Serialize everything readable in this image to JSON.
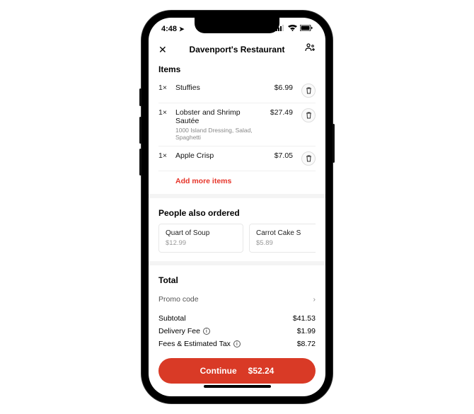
{
  "statusbar": {
    "time": "4:48"
  },
  "header": {
    "title": "Davenport's Restaurant"
  },
  "sections": {
    "items_title": "Items",
    "also_ordered_title": "People also ordered",
    "total_title": "Total"
  },
  "items": [
    {
      "qty": "1×",
      "name": "Stuffies",
      "sub": "",
      "price": "$6.99"
    },
    {
      "qty": "1×",
      "name": "Lobster and Shrimp Sautée",
      "sub": "1000 Island Dressing, Salad, Spaghetti",
      "price": "$27.49"
    },
    {
      "qty": "1×",
      "name": "Apple Crisp",
      "sub": "",
      "price": "$7.05"
    }
  ],
  "add_more_label": "Add more items",
  "suggestions": [
    {
      "name": "Quart of Soup",
      "price": "$12.99"
    },
    {
      "name": "Carrot Cake S",
      "price": "$5.89"
    }
  ],
  "promo": {
    "label": "Promo code"
  },
  "totals": {
    "subtotal_label": "Subtotal",
    "subtotal_value": "$41.53",
    "delivery_label": "Delivery Fee",
    "delivery_value": "$1.99",
    "fees_label": "Fees & Estimated Tax",
    "fees_value": "$8.72"
  },
  "cta": {
    "label": "Continue",
    "total": "$52.24"
  }
}
